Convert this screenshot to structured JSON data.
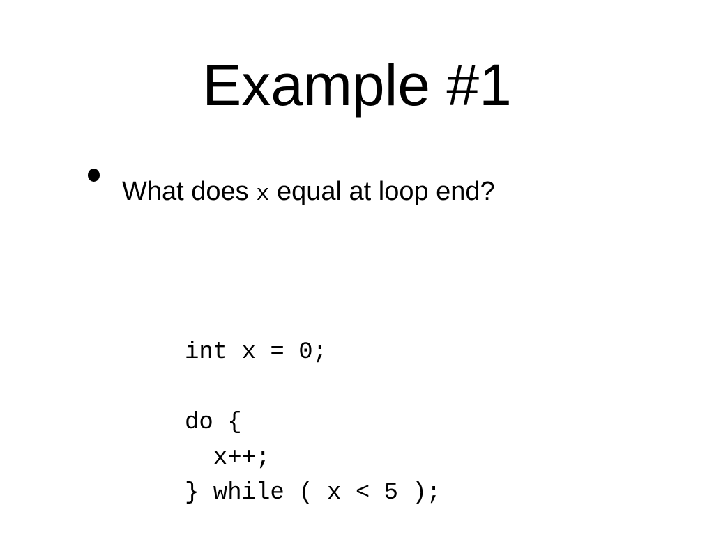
{
  "slide": {
    "title": "Example #1",
    "bullet": {
      "text_before": "What does ",
      "code_var": "x",
      "text_after": " equal at loop end?"
    },
    "code_lines": [
      "int x = 0;",
      "",
      "do {",
      "  x++;",
      "} while ( x < 5 );"
    ]
  }
}
